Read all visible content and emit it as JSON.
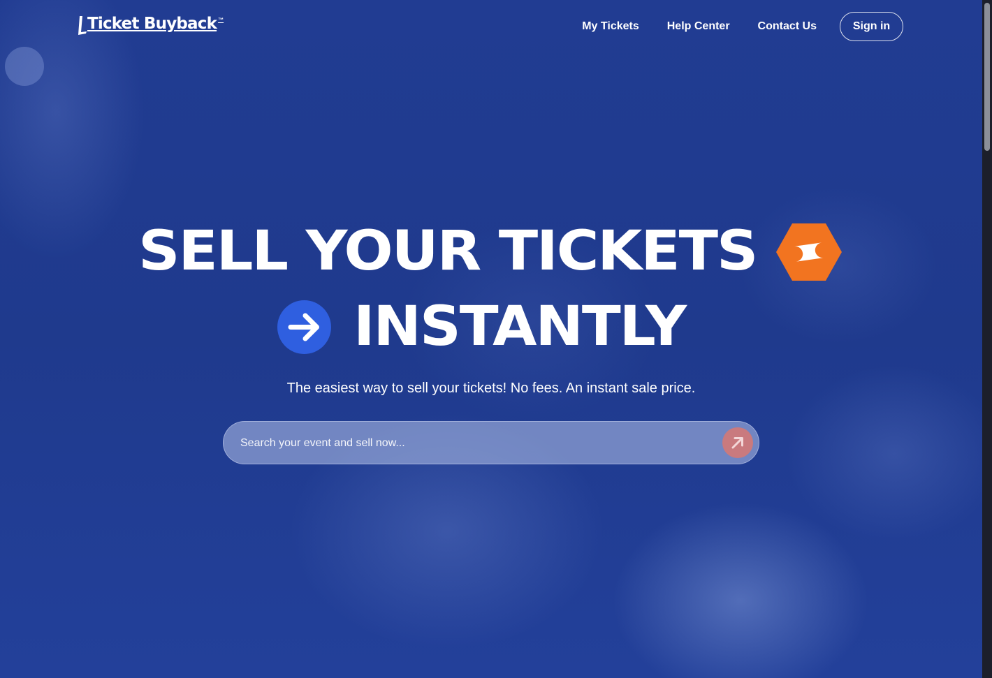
{
  "brand": {
    "name": "Ticket Buyback",
    "tm": "™"
  },
  "nav": {
    "items": [
      "My Tickets",
      "Help Center",
      "Contact Us"
    ],
    "sign_in": "Sign in"
  },
  "hero": {
    "line1": "SELL YOUR TICKETS",
    "line2": "INSTANTLY",
    "subtitle": "The easiest way to sell your tickets! No fees. An instant sale price.",
    "ticket_icon": "ticket-icon",
    "arrow_icon": "arrow-right-icon"
  },
  "search": {
    "placeholder": "Search your event and sell now...",
    "value": "",
    "button_icon": "arrow-up-right-icon"
  },
  "colors": {
    "background": "#1f3a8e",
    "accent_orange": "#f27420",
    "accent_blue": "#2f5fe0",
    "search_button": "#c97a7e"
  }
}
